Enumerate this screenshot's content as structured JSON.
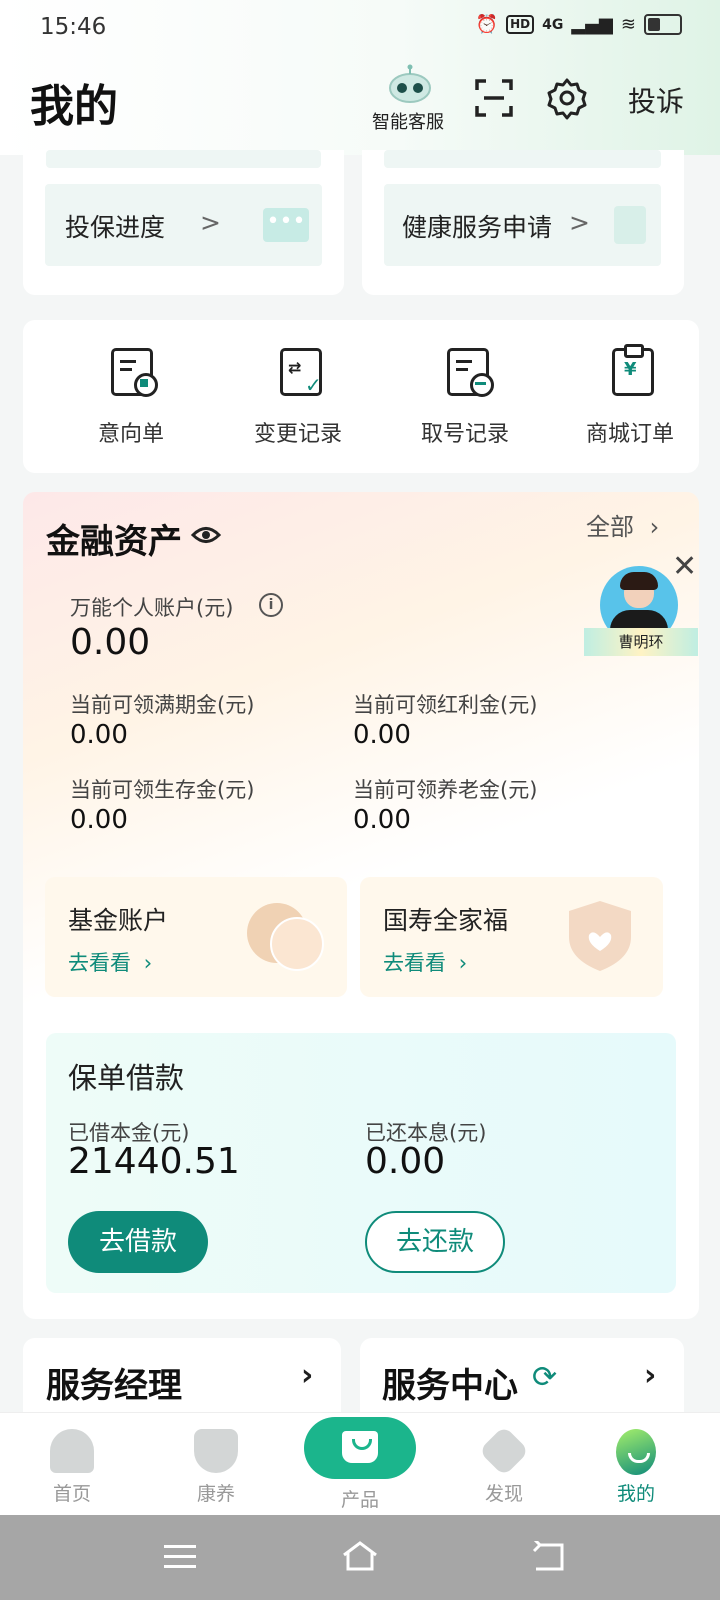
{
  "status": {
    "time": "15:46",
    "net": "4G",
    "hd": "HD"
  },
  "header": {
    "title": "我的",
    "customer_service": "智能客服",
    "complaint": "投诉"
  },
  "quick_cards": {
    "left": "投保进度",
    "right": "健康服务申请",
    "chevron": ">"
  },
  "shortcuts": [
    {
      "label": "意向单",
      "icon": "intent-form-icon"
    },
    {
      "label": "变更记录",
      "icon": "change-record-icon"
    },
    {
      "label": "取号记录",
      "icon": "queue-number-icon"
    },
    {
      "label": "商城订单",
      "icon": "mall-order-icon"
    }
  ],
  "finance": {
    "title": "金融资产",
    "all_link": "全部",
    "universal_label": "万能个人账户(元)",
    "universal_value": "0.00",
    "items": [
      {
        "label": "当前可领满期金(元)",
        "value": "0.00"
      },
      {
        "label": "当前可领红利金(元)",
        "value": "0.00"
      },
      {
        "label": "当前可领生存金(元)",
        "value": "0.00"
      },
      {
        "label": "当前可领养老金(元)",
        "value": "0.00"
      }
    ],
    "fund": {
      "title": "基金账户",
      "link": "去看看"
    },
    "family": {
      "title": "国寿全家福",
      "link": "去看看"
    },
    "loan": {
      "title": "保单借款",
      "borrowed_label": "已借本金(元)",
      "borrowed_value": "21440.51",
      "repaid_label": "已还本息(元)",
      "repaid_value": "0.00",
      "borrow_btn": "去借款",
      "repay_btn": "去还款"
    }
  },
  "agent": {
    "name": "曹明环"
  },
  "services": {
    "manager": "服务经理",
    "center": "服务中心"
  },
  "tabs": [
    {
      "label": "首页"
    },
    {
      "label": "康养"
    },
    {
      "label": "产品"
    },
    {
      "label": "发现"
    },
    {
      "label": "我的"
    }
  ],
  "colors": {
    "accent": "#0f8b7a",
    "active_tab": "#0f8b7a"
  }
}
